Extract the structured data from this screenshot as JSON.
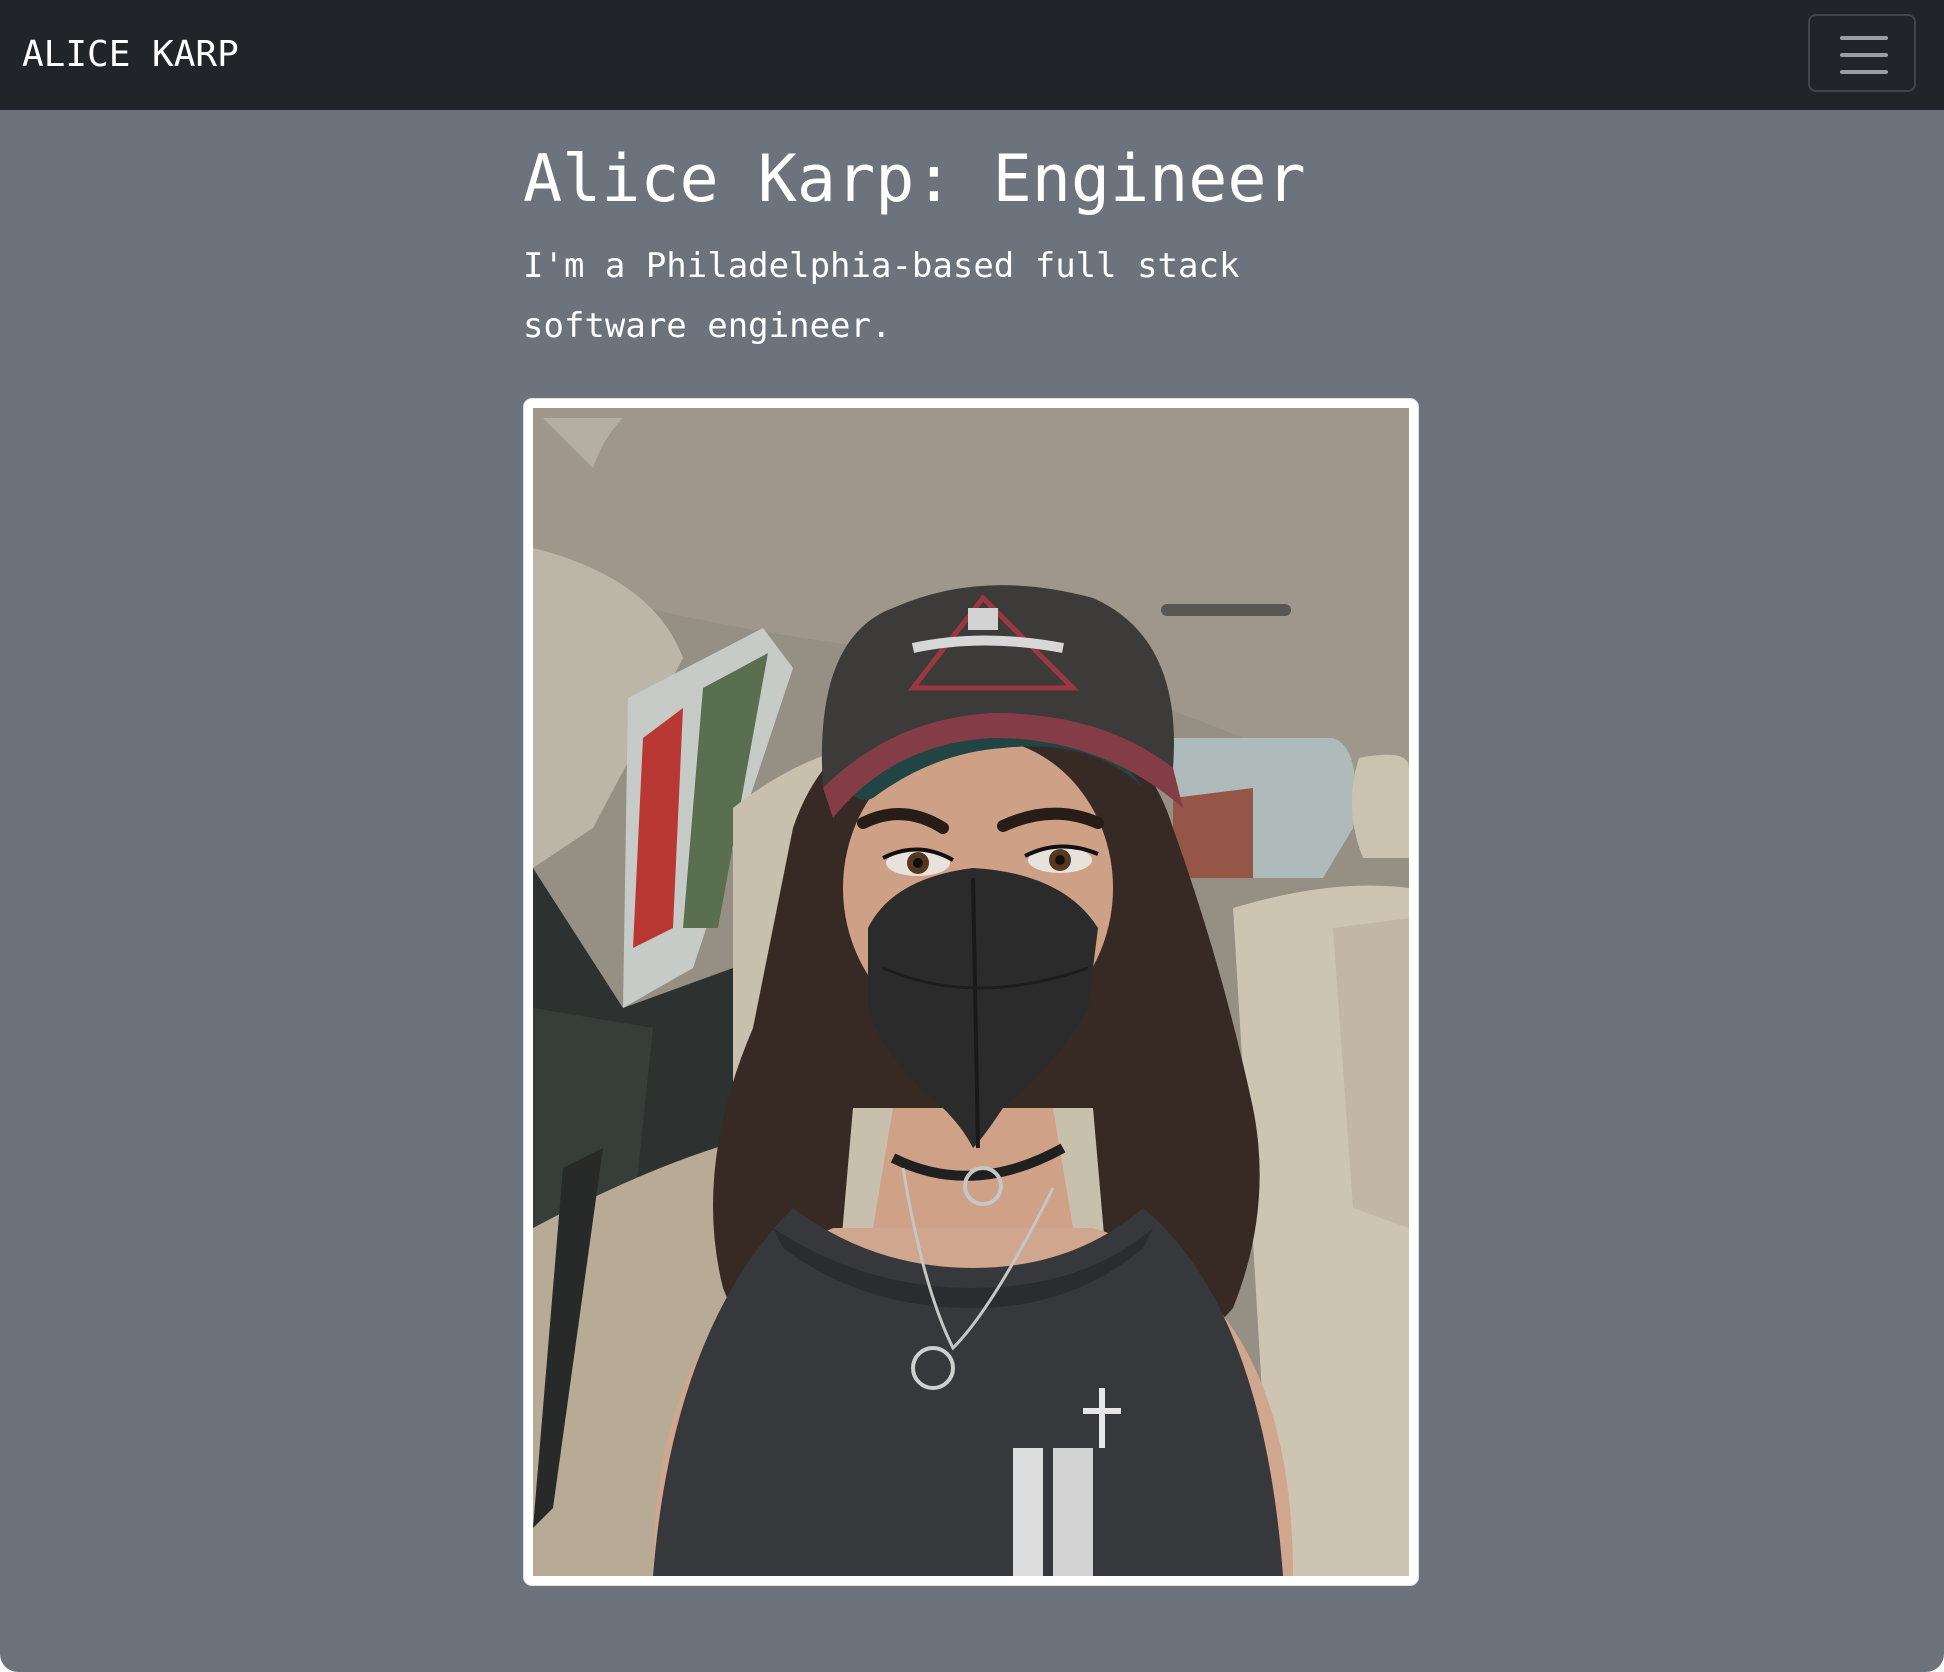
{
  "navbar": {
    "brand": "ALICE KARP",
    "toggler_label": "Toggle navigation"
  },
  "hero": {
    "title": "Alice Karp: Engineer",
    "lead": "I'm a Philadelphia-based full stack software engineer."
  },
  "photo": {
    "alt": "Selfie of Alice Karp in a car wearing a cap and black mask"
  },
  "colors": {
    "navbar_bg": "#212529",
    "page_bg": "#6d737d",
    "text": "#ffffff"
  }
}
